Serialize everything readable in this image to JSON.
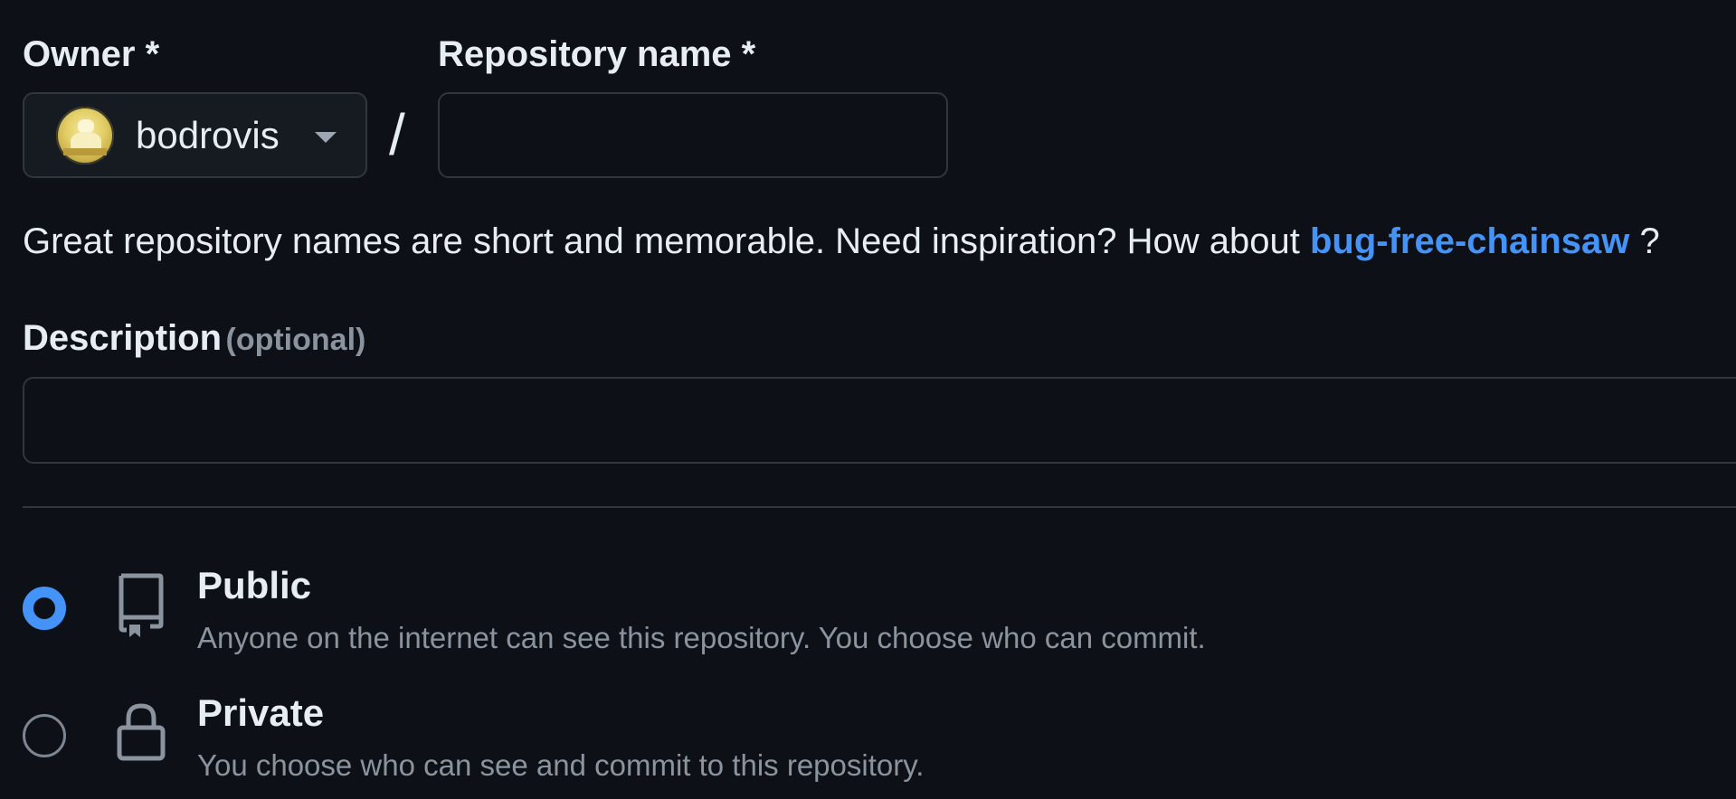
{
  "owner": {
    "label": "Owner *",
    "selected": "bodrovis",
    "avatar_icon": "user-avatar"
  },
  "separator": "/",
  "repository": {
    "label": "Repository name *",
    "value": ""
  },
  "hint": {
    "text": "Great repository names are short and memorable. Need inspiration? How about ",
    "suggestion": "bug-free-chainsaw",
    "suffix": " ?"
  },
  "description": {
    "label": "Description",
    "optional": "(optional)",
    "value": ""
  },
  "visibility": {
    "options": [
      {
        "title": "Public",
        "description": "Anyone on the internet can see this repository. You choose who can commit.",
        "icon": "repo-icon",
        "checked": true
      },
      {
        "title": "Private",
        "description": "You choose who can see and commit to this repository.",
        "icon": "lock-icon",
        "checked": false
      }
    ]
  },
  "colors": {
    "background": "#0d1117",
    "link": "#4493f8",
    "muted": "#8b949e",
    "border": "#30363d"
  }
}
